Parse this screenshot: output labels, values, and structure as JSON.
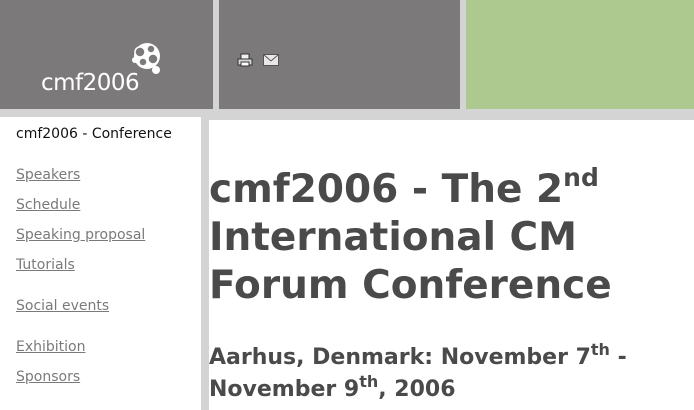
{
  "logo": {
    "text": "cmf2006"
  },
  "toolbar": {
    "print_icon": "print-icon",
    "email_icon": "email-icon"
  },
  "sidebar": {
    "title": "cmf2006 - Conference",
    "items": [
      {
        "label": "Speakers"
      },
      {
        "label": "Schedule"
      },
      {
        "label": "Speaking proposal"
      },
      {
        "label": "Tutorials"
      },
      {
        "label": "Social events"
      },
      {
        "label": "Exhibition"
      },
      {
        "label": "Sponsors"
      }
    ]
  },
  "main": {
    "headline": {
      "part1": "cmf2006 - The 2",
      "sup": "nd",
      "part2": "International CM Forum Conference"
    },
    "subhead": {
      "part1": "Aarhus, Denmark: November 7",
      "sup1": "th",
      "part2": " - November 9",
      "sup2": "th",
      "part3": ", 2006"
    }
  },
  "colors": {
    "header_gray": "#7b797a",
    "header_green": "#adc990",
    "background": "#d4d4d4",
    "link": "#7a7a7a",
    "heading": "#4a4a4a"
  }
}
